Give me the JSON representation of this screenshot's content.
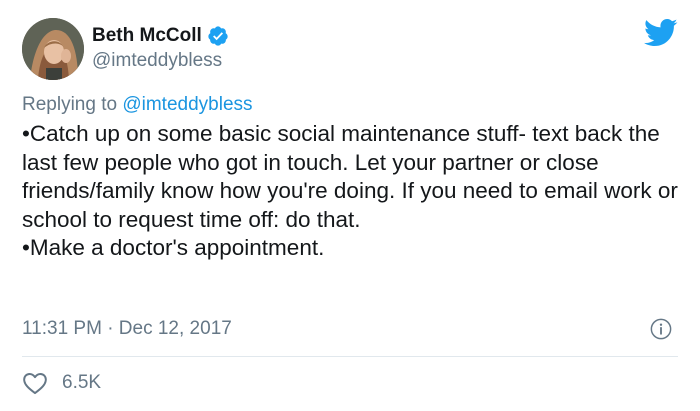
{
  "author": {
    "display_name": "Beth McColl",
    "handle": "@imteddybless",
    "verified": true,
    "avatar_icon": "profile-photo"
  },
  "header": {
    "brand_icon": "twitter-bird-icon",
    "brand_color": "#1da1f2"
  },
  "reply": {
    "prefix": "Replying to ",
    "mention": "@imteddybless",
    "mention_color": "#1b95e0"
  },
  "body": {
    "paragraphs": [
      "•Catch up on some basic social maintenance stuff- text back the last few people who got in touch. Let your partner or close friends/family know how you're doing. If you need to email work or school to request time off: do that.",
      "•Make a doctor's appointment."
    ]
  },
  "meta": {
    "timestamp": "11:31 PM · Dec 12, 2017",
    "info_icon": "info-icon"
  },
  "engagement": {
    "like_icon": "heart-icon",
    "likes": "6.5K"
  },
  "colors": {
    "text": "#14171a",
    "secondary": "#657786",
    "divider": "#e1e8ed",
    "verified": "#1da1f2"
  }
}
